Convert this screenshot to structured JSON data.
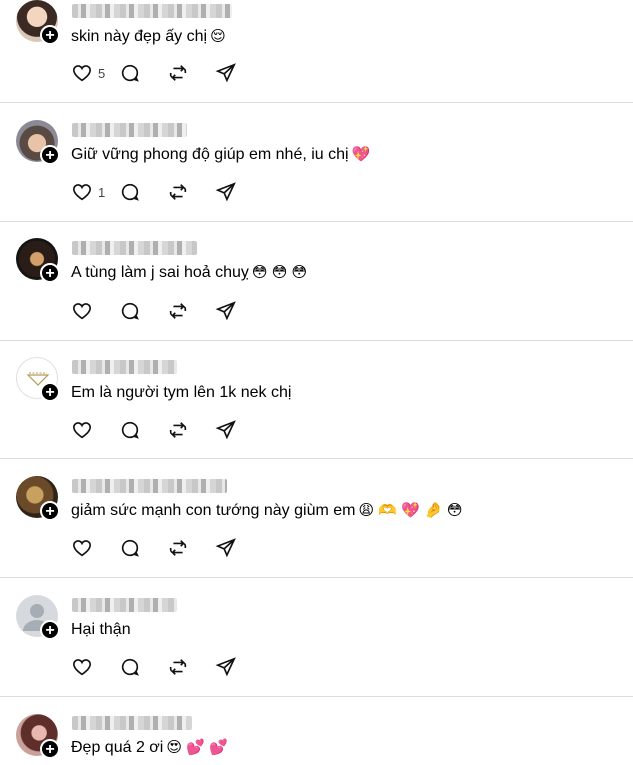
{
  "comments": [
    {
      "text": "skin này đẹp ấy chị",
      "emojis": "😌",
      "likes": "5",
      "avatar": "photo"
    },
    {
      "text": "Giữ vững phong độ giúp em nhé, iu chị",
      "emojis": "💖",
      "likes": "1",
      "avatar": "photo"
    },
    {
      "text": "A tùng làm j sai hoả chuỵ",
      "emojis": "😳 😳 😳",
      "likes": "",
      "avatar": "photo"
    },
    {
      "text": "Em là người tym lên 1k nek chị",
      "emojis": "",
      "likes": "",
      "avatar": "logo"
    },
    {
      "text": "giảm sức mạnh con tướng này giùm em",
      "emojis": "😩 🫶 💖 🤌 😳",
      "likes": "",
      "avatar": "photo"
    },
    {
      "text": "Hại thận",
      "emojis": "",
      "likes": "",
      "avatar": "default"
    },
    {
      "text": "Đẹp quá 2 ơi",
      "emojis": "😍 💕 💕",
      "likes": "",
      "avatar": "photo"
    }
  ],
  "icons": {
    "like": "heart-icon",
    "reply": "reply-icon",
    "repost": "repost-icon",
    "share": "share-icon",
    "follow": "plus-icon"
  },
  "colors": {
    "divider": "#dcdcdc",
    "badge": "#000000"
  }
}
